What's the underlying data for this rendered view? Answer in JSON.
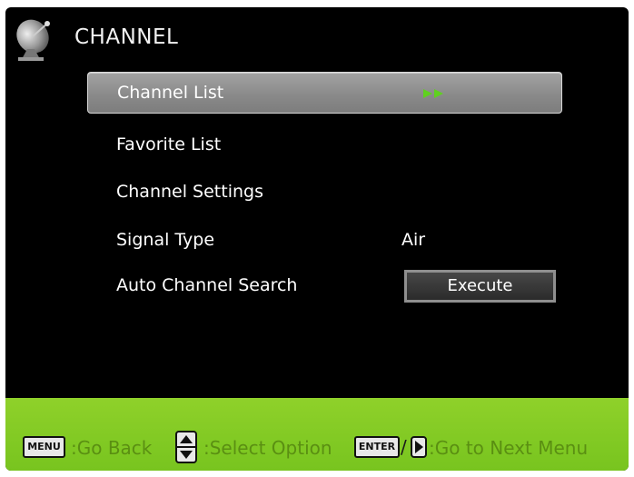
{
  "header": {
    "title": "CHANNEL",
    "icon": "satellite-dish-icon"
  },
  "menu": {
    "items": [
      {
        "label": "Channel List",
        "value": "",
        "selected": true,
        "icon": "double-arrow-right-icon"
      },
      {
        "label": "Favorite List",
        "value": ""
      },
      {
        "label": "Channel Settings",
        "value": ""
      },
      {
        "label": "Signal Type",
        "value": "Air"
      },
      {
        "label": "Auto Channel Search",
        "button": "Execute"
      }
    ]
  },
  "footer": {
    "menu_key": "MENU",
    "go_back": ":Go Back",
    "select_option": ":Select Option",
    "enter_key": "ENTER",
    "slash": "/",
    "next_menu": ":Go to Next Menu"
  },
  "colors": {
    "background": "#000000",
    "footer": "#86cc24",
    "hint_text": "#5a8f12",
    "arrow_accent": "#5fd11f"
  }
}
